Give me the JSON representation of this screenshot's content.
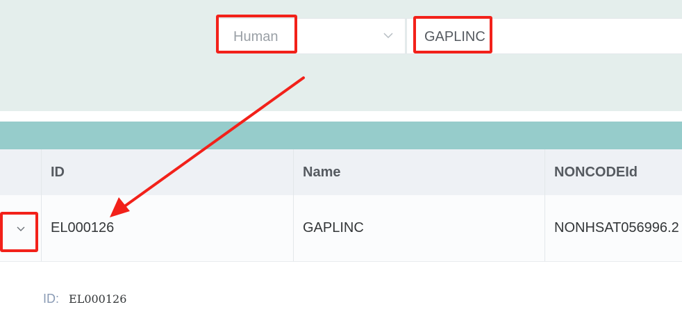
{
  "search": {
    "species_value": "Human",
    "query_value": "GAPLINC"
  },
  "table": {
    "headers": [
      "ID",
      "Name",
      "NONCODEId"
    ],
    "rows": [
      {
        "id": "EL000126",
        "name": "GAPLINC",
        "noncode": "NONHSAT056996.2"
      }
    ]
  },
  "detail": {
    "label": "ID:",
    "value": "EL000126"
  },
  "colors": {
    "search_bg": "#e4eeec",
    "teal_band": "#96cccb",
    "annotation_red": "#f2211a"
  },
  "icons": {
    "select_chevron": "chevron-down-icon",
    "row_expand": "chevron-down-icon"
  }
}
